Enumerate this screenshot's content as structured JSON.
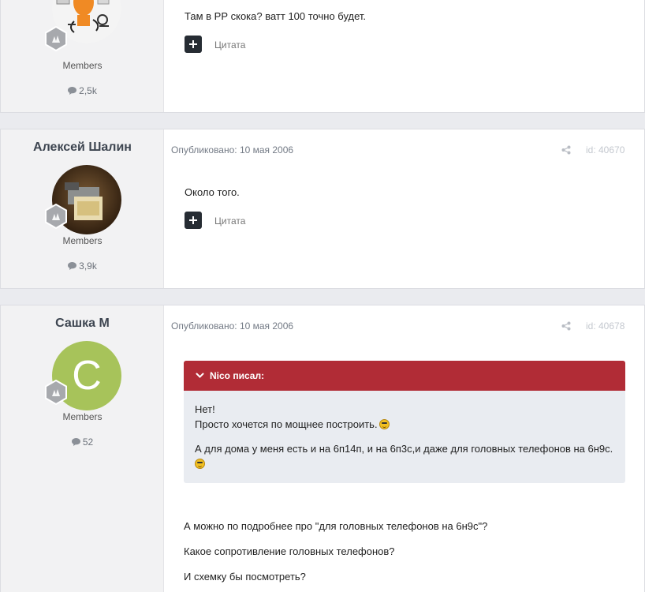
{
  "posts": [
    {
      "author_name": "",
      "group": "Members",
      "post_count": "2,5k",
      "body": [
        "Там в РР скока? ватт 100 точно будет."
      ],
      "quote_label": "Цитата"
    },
    {
      "author_name": "Алексей Шалин",
      "published": "Опубликовано: 10 мая 2006",
      "post_id": "id: 40670",
      "group": "Members",
      "post_count": "3,9k",
      "body": [
        "Около того."
      ],
      "quote_label": "Цитата"
    },
    {
      "author_name": "Сашка М",
      "avatar_letter": "C",
      "avatar_color": "#a7c35a",
      "published": "Опубликовано: 10 мая 2006",
      "post_id": "id: 40678",
      "group": "Members",
      "post_count": "52",
      "quote": {
        "header": "Nico писал:",
        "lines": [
          "Нет!",
          "Просто хочется по мощнее построить."
        ],
        "para2": "А для дома у меня есть и на 6п14п, и на 6п3с,и даже для головных телефонов на 6н9с."
      },
      "body": [
        "А можно по подробнее про \"для головных телефонов на 6н9с\"?",
        "Какое сопротивление головных телефонов?",
        "И схемку бы посмотреть?"
      ]
    }
  ],
  "colors": {
    "quote_header": "#b12c36",
    "quote_bg": "#e9ecf1",
    "author_panel": "#f2f2f3",
    "page_bg": "#eaebef"
  },
  "icons": [
    "rank-badge-icon",
    "comment-icon",
    "share-icon",
    "plus-icon",
    "chevron-down-icon",
    "smiley-icon"
  ]
}
